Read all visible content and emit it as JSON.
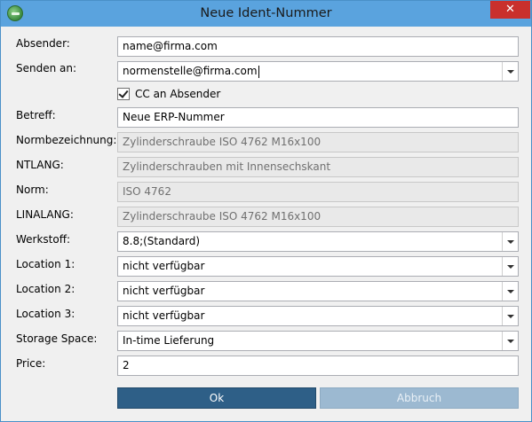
{
  "window": {
    "title": "Neue Ident-Nummer",
    "close_glyph": "✕",
    "app_icon": "app-logo-icon",
    "close_icon": "close-icon"
  },
  "form": {
    "absender": {
      "label": "Absender:",
      "value": "name@firma.com"
    },
    "senden_an": {
      "label": "Senden an:",
      "value": "normenstelle@firma.com"
    },
    "cc": {
      "label": "CC an Absender",
      "checked": true
    },
    "betreff": {
      "label": "Betreff:",
      "value": "Neue ERP-Nummer"
    },
    "normbezeichnung": {
      "label": "Normbezeichnung:",
      "value": "Zylinderschraube ISO 4762 M16x100"
    },
    "ntlang": {
      "label": "NTLANG:",
      "value": "Zylinderschrauben mit Innensechskant"
    },
    "norm": {
      "label": "Norm:",
      "value": "ISO 4762"
    },
    "linalang": {
      "label": "LINALANG:",
      "value": "Zylinderschraube ISO 4762 M16x100"
    },
    "werkstoff": {
      "label": "Werkstoff:",
      "value": "8.8;(Standard)"
    },
    "location1": {
      "label": "Location 1:",
      "value": "nicht verfügbar"
    },
    "location2": {
      "label": "Location 2:",
      "value": "nicht verfügbar"
    },
    "location3": {
      "label": "Location 3:",
      "value": "nicht verfügbar"
    },
    "storage_space": {
      "label": "Storage Space:",
      "value": "In-time Lieferung"
    },
    "price": {
      "label": "Price:",
      "value": "2"
    }
  },
  "buttons": {
    "ok": "Ok",
    "cancel": "Abbruch"
  },
  "colors": {
    "titlebar": "#5aa3de",
    "ok_button": "#2e5f87",
    "cancel_button_disabled": "#9cb9d1",
    "close_button": "#c9302c"
  }
}
